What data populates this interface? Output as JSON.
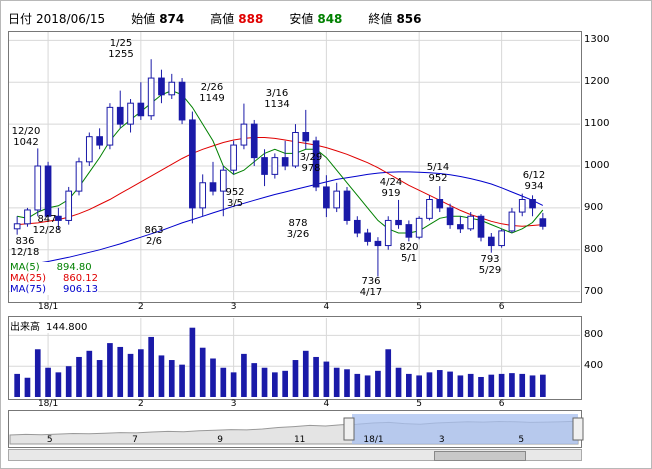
{
  "header": {
    "date_label": "日付",
    "date": "2018/06/15",
    "open_label": "始値",
    "open": "874",
    "high_label": "高値",
    "high": "888",
    "low_label": "安値",
    "low": "848",
    "close_label": "終値",
    "close": "856"
  },
  "price_axis": [
    "1300",
    "1200",
    "1100",
    "1000",
    "900",
    "800",
    "700"
  ],
  "volume_axis": [
    "800",
    "400"
  ],
  "x_months": [
    "18/1",
    "2",
    "3",
    "4",
    "5",
    "6"
  ],
  "nav_months": [
    "5",
    "7",
    "9",
    "11",
    "18/1",
    "3",
    "5"
  ],
  "legend": {
    "ma5_label": "MA(5)",
    "ma5": "894.80",
    "ma25_label": "MA(25)",
    "ma25": "860.12",
    "ma75_label": "MA(75)",
    "ma75": "906.13"
  },
  "volume_label": "出来高",
  "volume_value": "144.800",
  "annotations": [
    {
      "text": "12/20\n1042"
    },
    {
      "text": "1/25\n1255"
    },
    {
      "text": "2/26\n1149"
    },
    {
      "text": "3/16\n1134"
    },
    {
      "text": "3/29\n978"
    },
    {
      "text": "5/14\n952"
    },
    {
      "text": "4/24\n919"
    },
    {
      "text": "6/12\n934"
    },
    {
      "text": "836\n12/18"
    },
    {
      "text": "847\n12/28"
    },
    {
      "text": "863\n2/6"
    },
    {
      "text": "952\n3/5"
    },
    {
      "text": "878\n3/26"
    },
    {
      "text": "736\n4/17"
    },
    {
      "text": "820\n5/1"
    },
    {
      "text": "793\n5/29"
    }
  ],
  "colors": {
    "up": "#1a1aa8",
    "down": "#1a1aa8",
    "ma5": "#008000",
    "ma25": "#e00000",
    "ma75": "#0000cc",
    "nav_fill": "#a8c0f0"
  },
  "chart_data": {
    "type": "candlestick",
    "price_ylim": [
      680,
      1320
    ],
    "volume_ylim": [
      0,
      1000
    ],
    "candles": [
      {
        "o": 850,
        "h": 880,
        "l": 836,
        "c": 862
      },
      {
        "o": 862,
        "h": 900,
        "l": 855,
        "c": 895
      },
      {
        "o": 895,
        "h": 1042,
        "l": 880,
        "c": 1000
      },
      {
        "o": 1000,
        "h": 1010,
        "l": 870,
        "c": 880
      },
      {
        "o": 880,
        "h": 900,
        "l": 847,
        "c": 870
      },
      {
        "o": 870,
        "h": 950,
        "l": 860,
        "c": 940
      },
      {
        "o": 940,
        "h": 1020,
        "l": 930,
        "c": 1010
      },
      {
        "o": 1010,
        "h": 1080,
        "l": 1000,
        "c": 1070
      },
      {
        "o": 1070,
        "h": 1090,
        "l": 1040,
        "c": 1050
      },
      {
        "o": 1050,
        "h": 1150,
        "l": 1040,
        "c": 1140
      },
      {
        "o": 1140,
        "h": 1180,
        "l": 1090,
        "c": 1100
      },
      {
        "o": 1100,
        "h": 1160,
        "l": 1080,
        "c": 1150
      },
      {
        "o": 1150,
        "h": 1200,
        "l": 1110,
        "c": 1120
      },
      {
        "o": 1120,
        "h": 1255,
        "l": 1110,
        "c": 1210
      },
      {
        "o": 1210,
        "h": 1230,
        "l": 1150,
        "c": 1170
      },
      {
        "o": 1170,
        "h": 1220,
        "l": 1160,
        "c": 1200
      },
      {
        "o": 1200,
        "h": 1210,
        "l": 1100,
        "c": 1110
      },
      {
        "o": 1110,
        "h": 1130,
        "l": 863,
        "c": 900
      },
      {
        "o": 900,
        "h": 980,
        "l": 880,
        "c": 960
      },
      {
        "o": 960,
        "h": 1010,
        "l": 930,
        "c": 940
      },
      {
        "o": 940,
        "h": 1000,
        "l": 880,
        "c": 990
      },
      {
        "o": 990,
        "h": 1060,
        "l": 980,
        "c": 1050
      },
      {
        "o": 1050,
        "h": 1149,
        "l": 1040,
        "c": 1100
      },
      {
        "o": 1100,
        "h": 1110,
        "l": 1000,
        "c": 1020
      },
      {
        "o": 1020,
        "h": 1040,
        "l": 952,
        "c": 980
      },
      {
        "o": 980,
        "h": 1030,
        "l": 970,
        "c": 1020
      },
      {
        "o": 1020,
        "h": 1060,
        "l": 990,
        "c": 1000
      },
      {
        "o": 1000,
        "h": 1100,
        "l": 995,
        "c": 1080
      },
      {
        "o": 1080,
        "h": 1134,
        "l": 1040,
        "c": 1060
      },
      {
        "o": 1060,
        "h": 1070,
        "l": 940,
        "c": 950
      },
      {
        "o": 950,
        "h": 978,
        "l": 878,
        "c": 900
      },
      {
        "o": 900,
        "h": 960,
        "l": 890,
        "c": 940
      },
      {
        "o": 940,
        "h": 950,
        "l": 860,
        "c": 870
      },
      {
        "o": 870,
        "h": 880,
        "l": 830,
        "c": 840
      },
      {
        "o": 840,
        "h": 850,
        "l": 810,
        "c": 820
      },
      {
        "o": 820,
        "h": 830,
        "l": 736,
        "c": 810
      },
      {
        "o": 810,
        "h": 880,
        "l": 800,
        "c": 870
      },
      {
        "o": 870,
        "h": 919,
        "l": 850,
        "c": 860
      },
      {
        "o": 860,
        "h": 870,
        "l": 820,
        "c": 830
      },
      {
        "o": 830,
        "h": 880,
        "l": 825,
        "c": 875
      },
      {
        "o": 875,
        "h": 930,
        "l": 870,
        "c": 920
      },
      {
        "o": 920,
        "h": 952,
        "l": 890,
        "c": 900
      },
      {
        "o": 900,
        "h": 910,
        "l": 850,
        "c": 860
      },
      {
        "o": 860,
        "h": 880,
        "l": 840,
        "c": 850
      },
      {
        "o": 850,
        "h": 890,
        "l": 845,
        "c": 880
      },
      {
        "o": 880,
        "h": 885,
        "l": 820,
        "c": 830
      },
      {
        "o": 830,
        "h": 840,
        "l": 793,
        "c": 810
      },
      {
        "o": 810,
        "h": 850,
        "l": 805,
        "c": 845
      },
      {
        "o": 845,
        "h": 900,
        "l": 840,
        "c": 890
      },
      {
        "o": 890,
        "h": 934,
        "l": 880,
        "c": 920
      },
      {
        "o": 920,
        "h": 930,
        "l": 880,
        "c": 900
      },
      {
        "o": 874,
        "h": 888,
        "l": 848,
        "c": 856
      }
    ],
    "ma5": [
      880,
      875,
      890,
      900,
      905,
      920,
      950,
      985,
      1020,
      1060,
      1090,
      1110,
      1130,
      1150,
      1170,
      1180,
      1170,
      1140,
      1100,
      1060,
      1000,
      980,
      990,
      1010,
      1030,
      1040,
      1030,
      1030,
      1040,
      1040,
      1020,
      990,
      960,
      930,
      900,
      870,
      850,
      840,
      840,
      845,
      860,
      875,
      880,
      880,
      875,
      870,
      860,
      850,
      840,
      850,
      865,
      895
    ],
    "ma25": [
      860,
      862,
      864,
      868,
      872,
      878,
      886,
      896,
      908,
      920,
      934,
      948,
      962,
      976,
      990,
      1004,
      1018,
      1030,
      1040,
      1048,
      1056,
      1062,
      1066,
      1068,
      1068,
      1066,
      1062,
      1058,
      1054,
      1050,
      1044,
      1036,
      1028,
      1018,
      1008,
      996,
      982,
      968,
      954,
      942,
      930,
      918,
      906,
      894,
      884,
      876,
      868,
      862,
      858,
      856,
      858,
      860
    ],
    "ma75": [
      760,
      764,
      768,
      772,
      777,
      782,
      788,
      794,
      800,
      807,
      814,
      822,
      830,
      838,
      846,
      855,
      864,
      872,
      880,
      888,
      896,
      904,
      911,
      918,
      925,
      932,
      938,
      944,
      950,
      956,
      962,
      968,
      972,
      976,
      980,
      983,
      985,
      986,
      986,
      985,
      984,
      982,
      979,
      975,
      970,
      964,
      957,
      948,
      938,
      928,
      918,
      906
    ],
    "volume": [
      300,
      250,
      620,
      380,
      320,
      400,
      520,
      600,
      480,
      700,
      650,
      560,
      620,
      780,
      540,
      480,
      420,
      900,
      640,
      500,
      380,
      320,
      560,
      440,
      380,
      320,
      340,
      480,
      600,
      520,
      460,
      380,
      360,
      300,
      280,
      340,
      620,
      380,
      300,
      280,
      320,
      350,
      330,
      280,
      300,
      260,
      290,
      300,
      310,
      300,
      280,
      290
    ],
    "nav_series": [
      0.3,
      0.32,
      0.31,
      0.33,
      0.35,
      0.34,
      0.36,
      0.38,
      0.37,
      0.4,
      0.42,
      0.41,
      0.44,
      0.46,
      0.48,
      0.47,
      0.5,
      0.55,
      0.58,
      0.62,
      0.6,
      0.64,
      0.66,
      0.7,
      0.72,
      0.68,
      0.66,
      0.7,
      0.72,
      0.74,
      0.73,
      0.75,
      0.74,
      0.72,
      0.73,
      0.74,
      0.76
    ]
  }
}
